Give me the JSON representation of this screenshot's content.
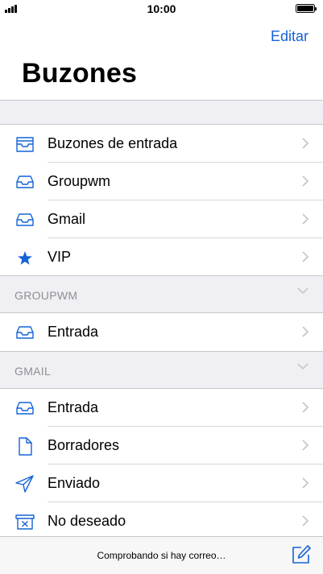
{
  "status_bar": {
    "time": "10:00",
    "battery_level": 1.0
  },
  "header": {
    "edit_label": "Editar",
    "title": "Buzones"
  },
  "accent_color": "#1463d6",
  "main_section": {
    "items": [
      {
        "label": "Buzones de entrada",
        "icon": "all-inboxes-icon"
      },
      {
        "label": "Groupwm",
        "icon": "inbox-tray-icon"
      },
      {
        "label": "Gmail",
        "icon": "inbox-tray-icon"
      },
      {
        "label": "VIP",
        "icon": "star-icon"
      }
    ]
  },
  "groupwm_section": {
    "header": "GROUPWM",
    "items": [
      {
        "label": "Entrada",
        "icon": "inbox-tray-icon"
      }
    ]
  },
  "gmail_section": {
    "header": "GMAIL",
    "items": [
      {
        "label": "Entrada",
        "icon": "inbox-tray-icon"
      },
      {
        "label": "Borradores",
        "icon": "document-icon"
      },
      {
        "label": "Enviado",
        "icon": "paper-plane-icon"
      },
      {
        "label": "No deseado",
        "icon": "junk-bin-icon"
      }
    ]
  },
  "toolbar": {
    "status_text": "Comprobando si hay correo…",
    "compose_icon": "compose-icon"
  }
}
